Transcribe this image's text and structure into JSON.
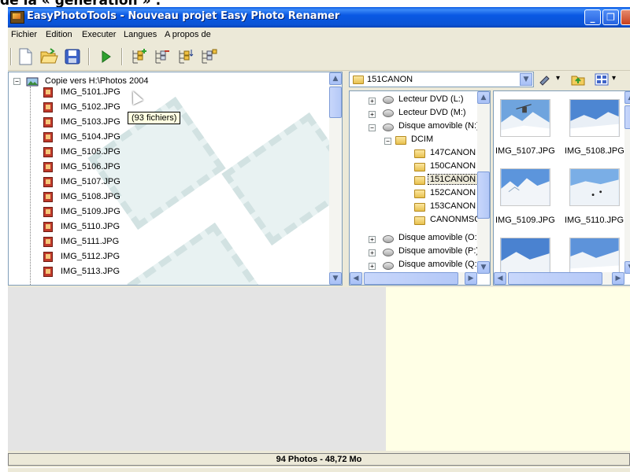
{
  "doc_caption": "de la « génération » :",
  "window": {
    "title": "EasyPhotoTools - Nouveau projet Easy Photo Renamer"
  },
  "menu": [
    "Fichier",
    "Edition",
    "Executer",
    "Langues",
    "A propos de"
  ],
  "toolbar": {
    "icons": [
      "new-file-icon",
      "open-folder-icon",
      "save-icon",
      "run-icon",
      "tree-add-icon",
      "tree-remove-icon",
      "tree-sort-icon",
      "tree-options-icon"
    ]
  },
  "left_tree": {
    "root_label": "Copie vers H:\\Photos 2004",
    "tooltip": "(93 fichiers)",
    "files": [
      "IMG_5101.JPG",
      "IMG_5102.JPG",
      "IMG_5103.JPG",
      "IMG_5104.JPG",
      "IMG_5105.JPG",
      "IMG_5106.JPG",
      "IMG_5107.JPG",
      "IMG_5108.JPG",
      "IMG_5109.JPG",
      "IMG_5110.JPG",
      "IMG_5111.JPG",
      "IMG_5112.JPG",
      "IMG_5113.JPG"
    ]
  },
  "folder_combo": {
    "value": "151CANON"
  },
  "folder_tree": {
    "drives_top": [
      "Lecteur DVD (L:)",
      "Lecteur DVD (M:)"
    ],
    "removable": "Disque amovible (N:)",
    "dcim": "DCIM",
    "folders": [
      "147CANON",
      "150CANON",
      "151CANON",
      "152CANON",
      "153CANON",
      "CANONMSC"
    ],
    "selected": "151CANON",
    "drives_bottom": [
      "Disque amovible (O:)",
      "Disque amovible (P:)",
      "Disque amovible (Q:)"
    ]
  },
  "thumbnails": [
    "IMG_5107.JPG",
    "IMG_5108.JPG",
    "IMG_5109.JPG",
    "IMG_5110.JPG"
  ],
  "status": {
    "text": "94 Photos - 48,72 Mo"
  },
  "colors": {
    "titlebar": "#0a5be3",
    "selection": "#316ac5",
    "preview_right_bg": "#ffffe6"
  }
}
